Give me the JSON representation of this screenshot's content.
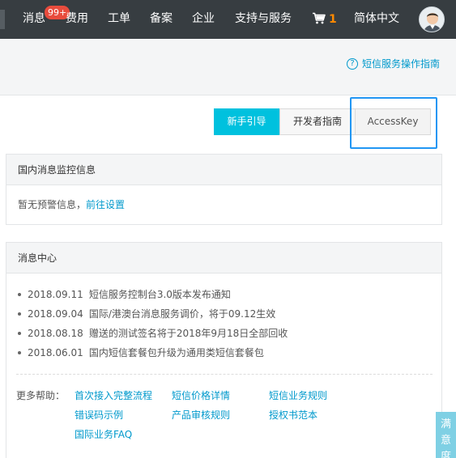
{
  "topnav": {
    "items": [
      {
        "label": "消息",
        "badge": "99+"
      },
      {
        "label": "费用"
      },
      {
        "label": "工单"
      },
      {
        "label": "备案"
      },
      {
        "label": "企业"
      },
      {
        "label": "支持与服务"
      },
      {
        "label": "简体中文"
      }
    ],
    "cart_count": "1"
  },
  "subheader": {
    "guide_link": "短信服务操作指南"
  },
  "buttons": {
    "quickstart": "新手引导",
    "developer": "开发者指南",
    "accesskey": "AccessKey"
  },
  "monitor_panel": {
    "title": "国内消息监控信息",
    "message": "暂无预警信息，",
    "link": "前往设置"
  },
  "message_center": {
    "title": "消息中心",
    "notices": [
      {
        "date": "2018.09.11",
        "text": "短信服务控制台3.0版本发布通知"
      },
      {
        "date": "2018.09.04",
        "text": "国际/港澳台消息服务调价，将于09.12生效"
      },
      {
        "date": "2018.08.18",
        "text": "赠送的测试签名将于2018年9月18日全部回收"
      },
      {
        "date": "2018.06.01",
        "text": "国内短信套餐包升级为通用类短信套餐包"
      }
    ],
    "more_label": "更多帮助：",
    "help_links": [
      "首次接入完整流程",
      "短信价格详情",
      "短信业务规则",
      "错误码示例",
      "产品审核规则",
      "授权书范本",
      "国际业务FAQ"
    ]
  },
  "float_tab": "满意度"
}
